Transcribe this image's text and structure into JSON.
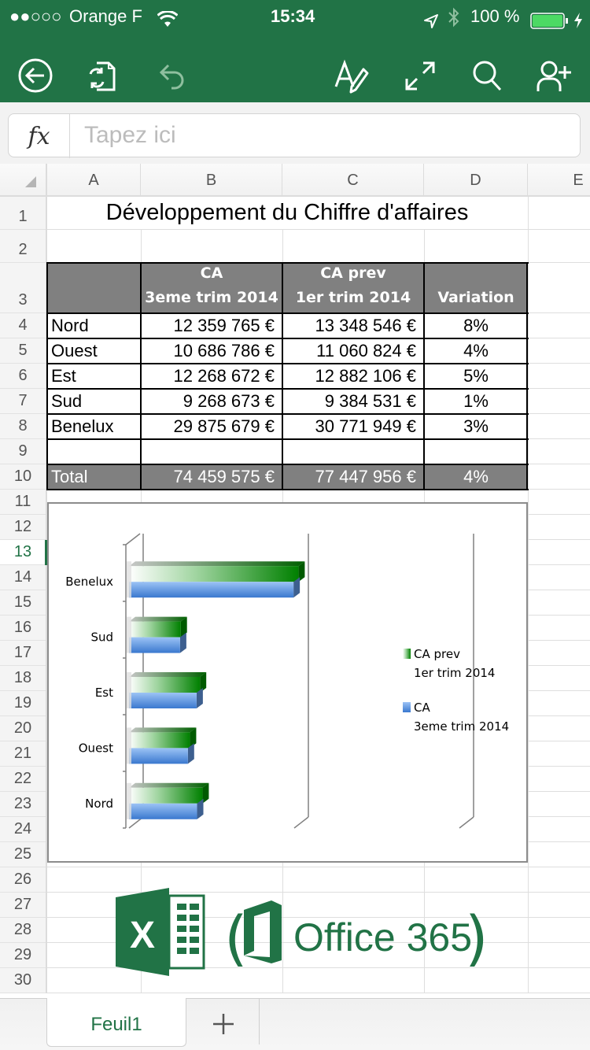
{
  "status_bar": {
    "signal": "●●○○○",
    "carrier": "Orange F",
    "time": "15:34",
    "battery_percent": "100 %",
    "battery_level": 1.0,
    "icons": [
      "wifi-icon",
      "location-icon",
      "bluetooth-icon",
      "battery-icon",
      "charging-icon"
    ]
  },
  "toolbar": {
    "left": [
      {
        "name": "back-button",
        "icon": "back-arrow-circle-icon"
      },
      {
        "name": "sync-file-button",
        "icon": "file-sync-icon"
      },
      {
        "name": "undo-button",
        "icon": "undo-icon",
        "enabled": false
      }
    ],
    "right": [
      {
        "name": "edit-format-button",
        "icon": "text-edit-pencil-icon"
      },
      {
        "name": "fullscreen-button",
        "icon": "expand-icon"
      },
      {
        "name": "search-button",
        "icon": "search-icon"
      },
      {
        "name": "share-add-person-button",
        "icon": "add-person-icon"
      }
    ]
  },
  "formula_bar": {
    "fx_label": "fx",
    "value": "",
    "placeholder": "Tapez ici"
  },
  "grid": {
    "columns": [
      "A",
      "B",
      "C",
      "D",
      "E"
    ],
    "rows": [
      "1",
      "2",
      "3",
      "4",
      "5",
      "6",
      "7",
      "8",
      "9",
      "10",
      "11",
      "12",
      "13",
      "14",
      "15",
      "16",
      "17",
      "18",
      "19",
      "20",
      "21",
      "22",
      "23",
      "24",
      "25",
      "26",
      "27",
      "28",
      "29",
      "30"
    ],
    "active_row": "13",
    "title": "Développement du Chiffre d'affaires",
    "table": {
      "headers": [
        {
          "line1": "",
          "line2": ""
        },
        {
          "line1": "CA",
          "line2": "3eme trim 2014"
        },
        {
          "line1": "CA prev",
          "line2": "1er trim 2014"
        },
        {
          "line1": "",
          "line2": "Variation"
        }
      ],
      "rows": [
        {
          "region": "Nord",
          "ca": "12 359 765 €",
          "ca_prev": "13 348 546 €",
          "variation": "8%"
        },
        {
          "region": "Ouest",
          "ca": "10 686 786 €",
          "ca_prev": "11 060 824 €",
          "variation": "4%"
        },
        {
          "region": "Est",
          "ca": "12 268 672 €",
          "ca_prev": "12 882 106 €",
          "variation": "5%"
        },
        {
          "region": "Sud",
          "ca": "9 268 673 €",
          "ca_prev": "9 384 531 €",
          "variation": "1%"
        },
        {
          "region": "Benelux",
          "ca": "29 875 679 €",
          "ca_prev": "30 771 949 €",
          "variation": "3%"
        },
        {
          "region": "",
          "ca": "",
          "ca_prev": "",
          "variation": ""
        }
      ],
      "total": {
        "region": "Total",
        "ca": "74 459 575 €",
        "ca_prev": "77 447 956 €",
        "variation": "4%"
      }
    }
  },
  "chart_data": {
    "type": "bar",
    "orientation": "horizontal",
    "style": "3d-clustered",
    "title": "",
    "categories": [
      "Nord",
      "Ouest",
      "Est",
      "Sud",
      "Benelux"
    ],
    "series": [
      {
        "name": "CA prev\n1er trim 2014",
        "legend_lines": [
          "CA prev",
          "1er trim 2014"
        ],
        "values": [
          13348546,
          11060824,
          12882106,
          9384531,
          30771949
        ],
        "color": "#008000"
      },
      {
        "name": "CA\n3eme trim 2014",
        "legend_lines": [
          "CA",
          "3eme trim 2014"
        ],
        "values": [
          12359765,
          10686786,
          12268672,
          9268673,
          29875679
        ],
        "color": "#4a86d8"
      }
    ],
    "xlim": [
      0,
      60000000
    ],
    "x_gridlines": [
      0,
      30000000,
      60000000
    ],
    "x_tick_labels_visible": false,
    "grid": true,
    "legend_position": "right"
  },
  "branding": {
    "app_logo": "excel-logo-icon",
    "suite_logo": "office-logo-icon",
    "open_paren": "(",
    "suite_text": "Office 365",
    "close_paren": ")",
    "color": "#217346"
  },
  "sheet_tabs": {
    "tabs": [
      {
        "label": "Feuil1",
        "active": true
      }
    ],
    "add_label": "+"
  }
}
